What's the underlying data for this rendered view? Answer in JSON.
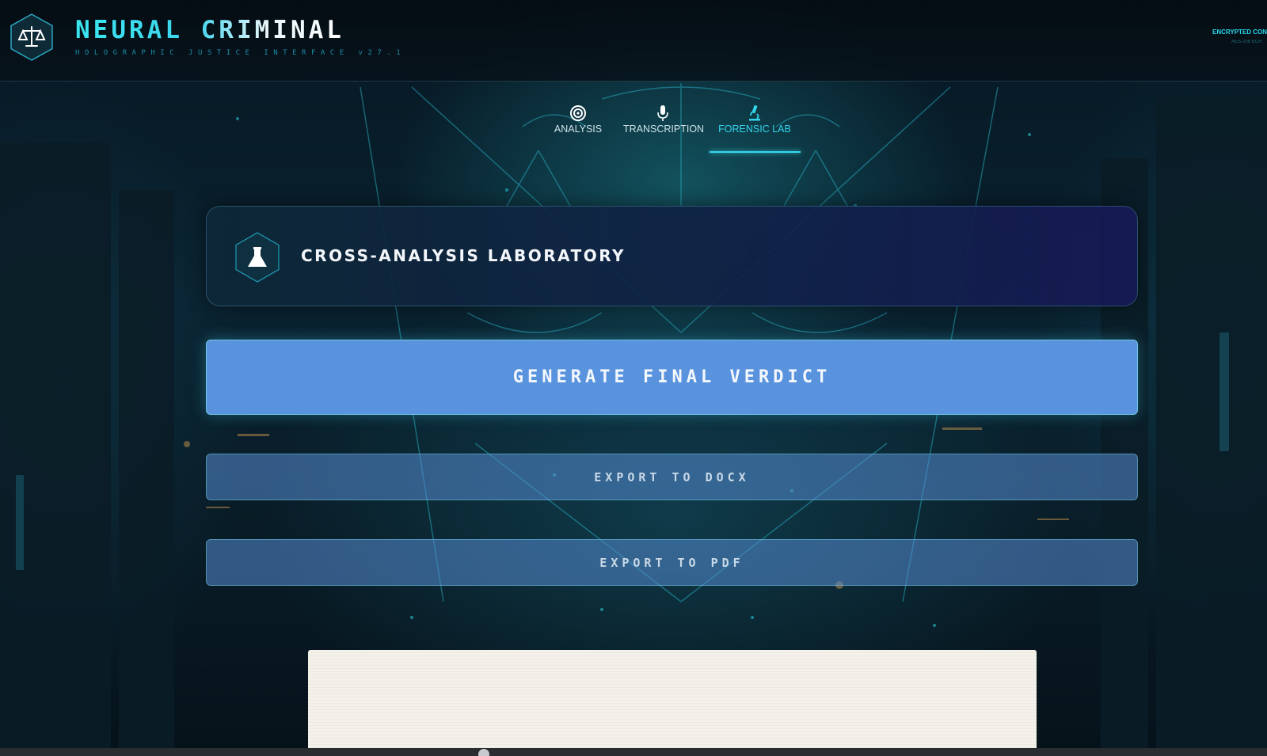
{
  "header": {
    "title": "NEURAL CRIMINAL",
    "subtitle": "HOLOGRAPHIC JUSTICE INTERFACE v27.1",
    "connection_status": "ENCRYPTED CONNE",
    "connection_detail": "AES-256 ECH",
    "logo_icon": "scales-of-justice-icon"
  },
  "tabs": [
    {
      "label": "ANALYSIS",
      "icon": "target-icon",
      "active": false
    },
    {
      "label": "TRANSCRIPTION",
      "icon": "microphone-icon",
      "active": false
    },
    {
      "label": "FORENSIC LAB",
      "icon": "microscope-icon",
      "active": true
    }
  ],
  "lab": {
    "title": "CROSS-ANALYSIS LABORATORY",
    "icon": "flask-icon"
  },
  "actions": {
    "verdict_label": "GENERATE FINAL VERDICT",
    "export_docx_label": "EXPORT TO DOCX",
    "export_pdf_label": "EXPORT TO PDF"
  },
  "colors": {
    "accent": "#38d8ee",
    "verdict_button": "#5a93dd",
    "panel": "#10224a"
  }
}
